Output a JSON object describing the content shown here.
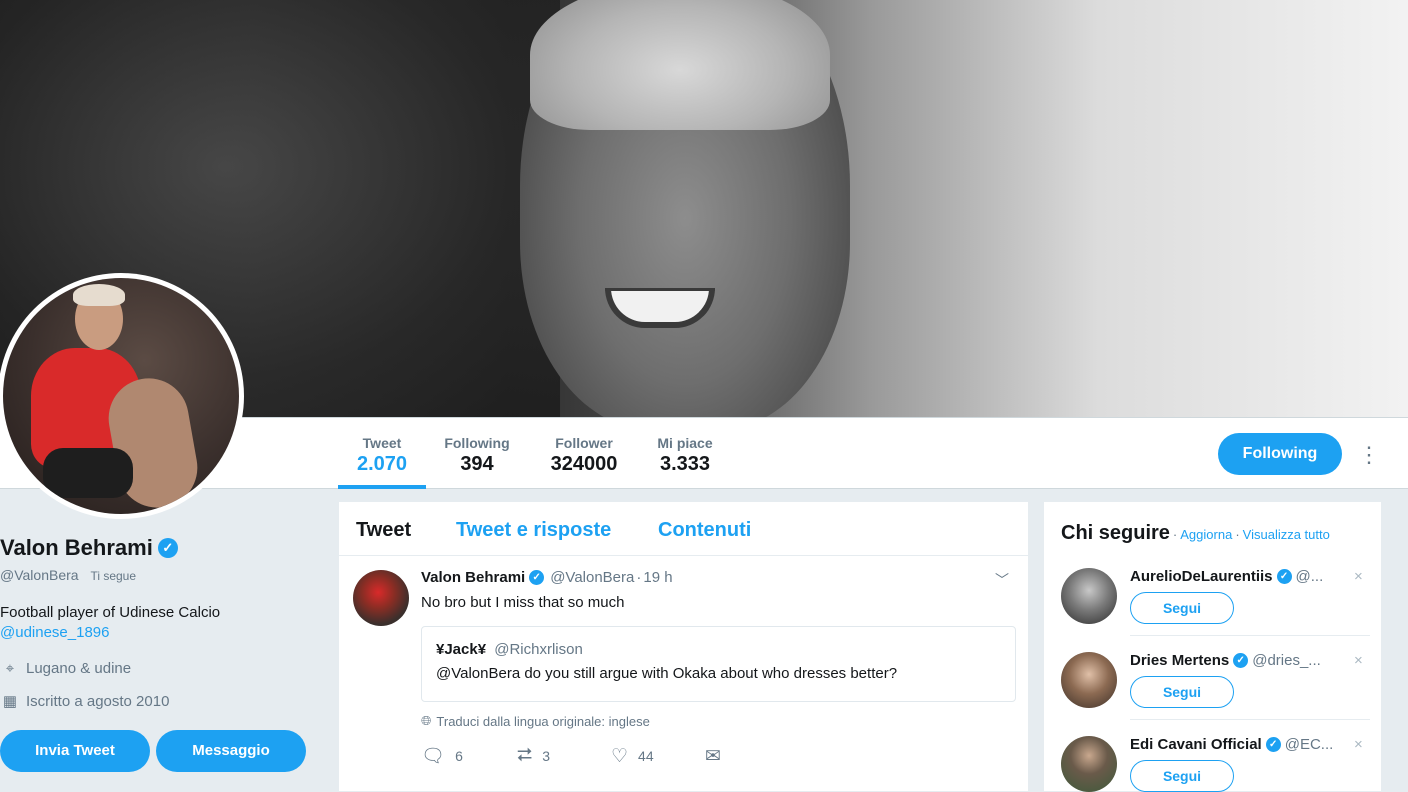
{
  "profile_nav": {
    "stats": [
      {
        "label": "Tweet",
        "value": "2.070"
      },
      {
        "label": "Following",
        "value": "394"
      },
      {
        "label": "Follower",
        "value": "324000"
      },
      {
        "label": "Mi piace",
        "value": "3.333"
      }
    ],
    "following_button": "Following",
    "more_icon": "⋮"
  },
  "profile": {
    "name": "Valon Behrami",
    "verified_icon": "✓",
    "handle": "@ValonBera",
    "follows_you": "Ti segue",
    "bio": "Football player of Udinese Calcio",
    "bio_link": "@udinese_1896",
    "location": "Lugano & udine",
    "joined": "Iscritto a agosto 2010",
    "tweet_button": "Invia Tweet",
    "message_button": "Messaggio"
  },
  "timeline": {
    "tabs": [
      "Tweet",
      "Tweet e risposte",
      "Contenuti"
    ],
    "tweet": {
      "name": "Valon Behrami",
      "handle": "@ValonBera",
      "dot": "·",
      "time": "19 h",
      "text": "No bro but I miss that so much",
      "quote": {
        "name": "¥Jack¥",
        "handle": "@Richxrlison",
        "text": "@ValonBera do you still argue with Okaka about who dresses better?"
      },
      "translate": "Traduci dalla lingua originale: inglese",
      "replies": "6",
      "retweets": "3",
      "likes": "44"
    }
  },
  "who_to_follow": {
    "title": "Chi seguire",
    "sep": "·",
    "refresh": "Aggiorna",
    "view_all": "Visualizza tutto",
    "follow_label": "Segui",
    "close": "×",
    "items": [
      {
        "name": "AurelioDeLaurentiis",
        "handle": "@..."
      },
      {
        "name": "Dries Mertens",
        "handle": "@dries_..."
      },
      {
        "name": "Edi Cavani Official",
        "handle": "@EC..."
      }
    ]
  },
  "colors": {
    "accent": "#1da1f2",
    "page_bg": "#e6ecf0",
    "muted_text": "#657786"
  }
}
